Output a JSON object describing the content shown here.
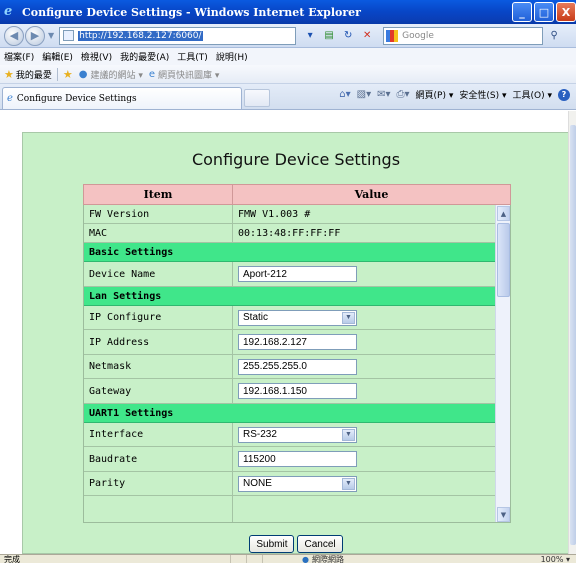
{
  "window": {
    "title": "Configure Device Settings - Windows Internet Explorer",
    "minimize": "_",
    "maximize": "□",
    "close": "X"
  },
  "address": {
    "url": "http://192.168.2.127:6060/",
    "search_placeholder": "Google"
  },
  "menu": [
    "檔案(F)",
    "編輯(E)",
    "檢視(V)",
    "我的最愛(A)",
    "工具(T)",
    "說明(H)"
  ],
  "favorites": {
    "label": "我的最愛",
    "items": [
      "建議的網站 ▾",
      "網頁快訊圖庫 ▾"
    ]
  },
  "tab": {
    "title": "Configure Device Settings"
  },
  "commands": {
    "page": "網頁(P) ▾",
    "safety": "安全性(S) ▾",
    "tools": "工具(O) ▾"
  },
  "page": {
    "title": "Configure Device Settings",
    "col_item": "Item",
    "col_value": "Value"
  },
  "settings": {
    "fw_label": "FW Version",
    "fw_value": "FMW V1.003 #",
    "mac_label": "MAC",
    "mac_value": "00:13:48:FF:FF:FF",
    "basic_header": "Basic Settings",
    "device_name_label": "Device Name",
    "device_name_value": "Aport-212",
    "lan_header": "Lan Settings",
    "ip_config_label": "IP Configure",
    "ip_config_value": "Static",
    "ip_address_label": "IP Address",
    "ip_address_value": "192.168.2.127",
    "netmask_label": "Netmask",
    "netmask_value": "255.255.255.0",
    "gateway_label": "Gateway",
    "gateway_value": "192.168.1.150",
    "uart_header": "UART1 Settings",
    "interface_label": "Interface",
    "interface_value": "RS-232",
    "baudrate_label": "Baudrate",
    "baudrate_value": "115200",
    "parity_label": "Parity",
    "parity_value": "NONE"
  },
  "actions": {
    "submit": "Submit",
    "cancel": "Cancel"
  },
  "status": {
    "text": "完成",
    "zone": "網際網路",
    "zoom": "100%"
  }
}
